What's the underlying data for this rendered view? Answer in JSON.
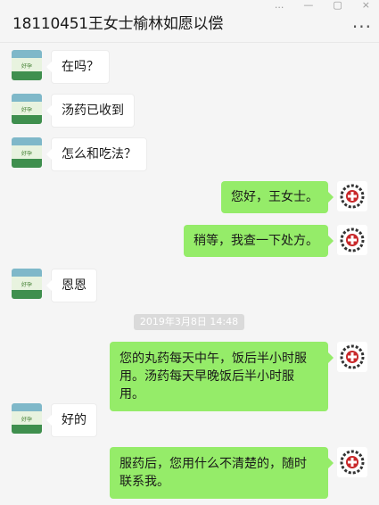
{
  "window": {
    "controls": [
      "...",
      "—",
      "▢",
      "×"
    ]
  },
  "header": {
    "title": "18110451王女士榆林如愿以偿",
    "more": "..."
  },
  "messages": [
    {
      "side": "left",
      "text": "在吗？"
    },
    {
      "side": "left",
      "text": "汤药已收到"
    },
    {
      "side": "left",
      "text": "怎么和吃法？"
    },
    {
      "side": "right",
      "text": "您好，王女士。"
    },
    {
      "side": "right",
      "text": "稍等，我查一下处方。"
    },
    {
      "side": "left",
      "text": "恩恩"
    },
    {
      "side": "right",
      "text": "您的丸药每天中午，饭后半小时服用。汤药每天早晚饭后半小时服用。"
    },
    {
      "side": "left",
      "text": "好的"
    },
    {
      "side": "right",
      "text": "服药后，您用什么不清楚的，随时联系我。"
    }
  ],
  "timestamp": "2019年3月8日  14:48",
  "colors": {
    "self_bubble": "#95ec69",
    "other_bubble": "#ffffff",
    "background": "#f5f5f5"
  }
}
